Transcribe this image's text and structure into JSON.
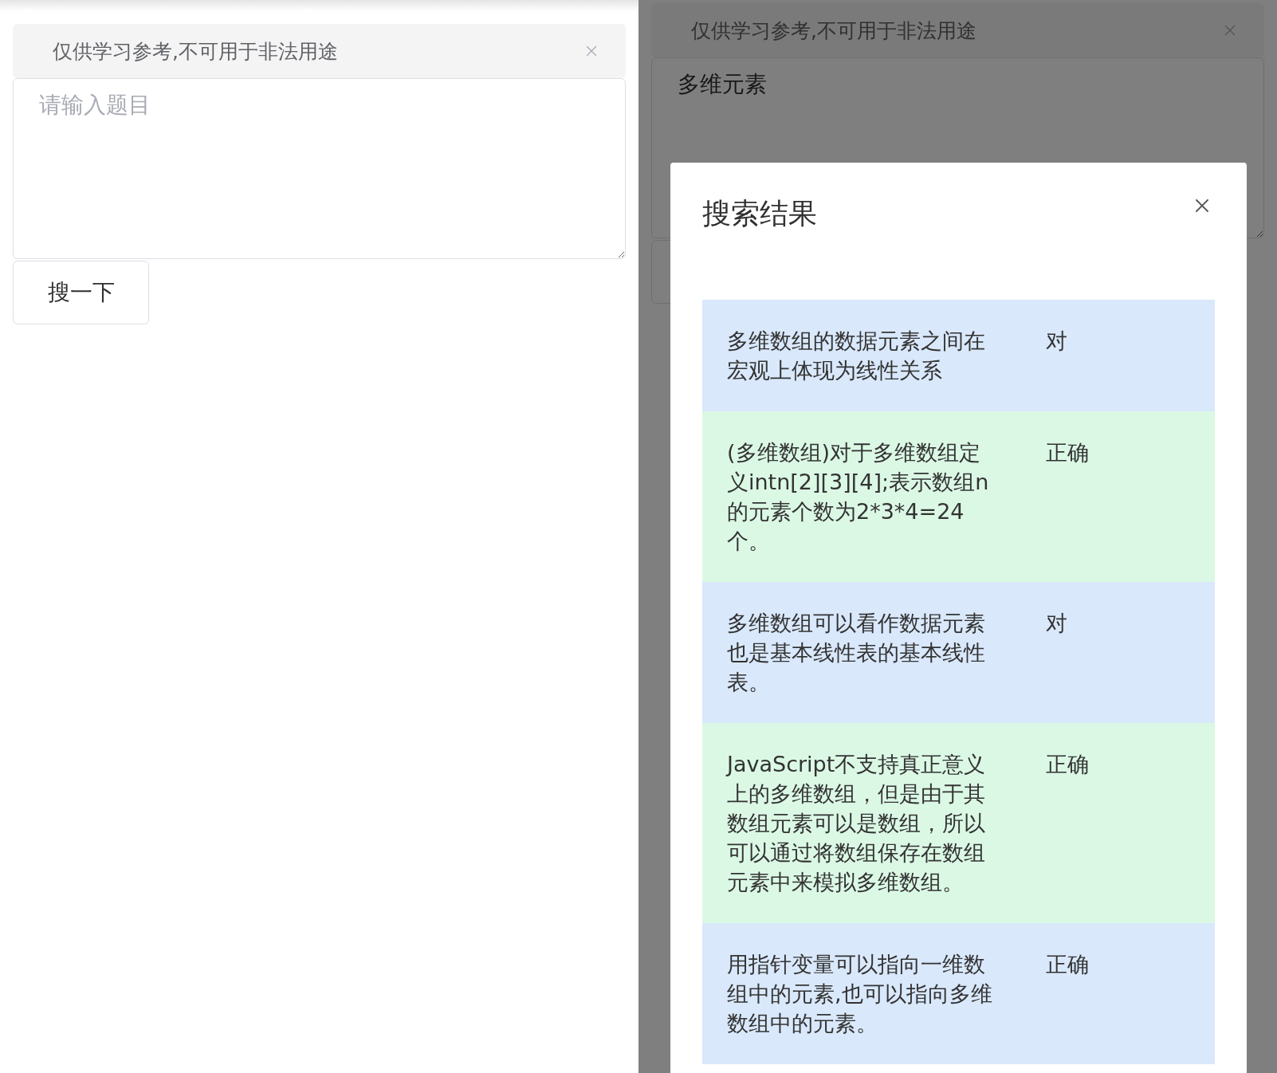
{
  "screens": [
    {
      "notice": {
        "text": "仅供学习参考,不可用于非法用途"
      },
      "question": {
        "placeholder": "请输入题目"
      },
      "search_button": {
        "label": "搜一下"
      }
    },
    {
      "notice": {
        "text": "仅供学习参考,不可用于非法用途"
      },
      "question": {
        "value": "多维元素"
      },
      "dialog": {
        "title": "搜索结果",
        "results": [
          {
            "question": "多维数组的数据元素之间在宏观上体现为线性关系",
            "answer": "对"
          },
          {
            "question": "(多维数组)对于多维数组定义intn[2][3][4];表示数组n的元素个数为2*3*4=24个。",
            "answer": "正确"
          },
          {
            "question": "多维数组可以看作数据元素也是基本线性表的基本线性表。",
            "answer": "对"
          },
          {
            "question": "JavaScript不支持真正意义上的多维数组，但是由于其数组元素可以是数组，所以可以通过将数组保存在数组元素中来模拟多维数组。",
            "answer": "正确"
          },
          {
            "question": "用指针变量可以指向一维数组中的元素,也可以指向多维数组中的元素。",
            "answer": "正确"
          }
        ]
      }
    }
  ]
}
